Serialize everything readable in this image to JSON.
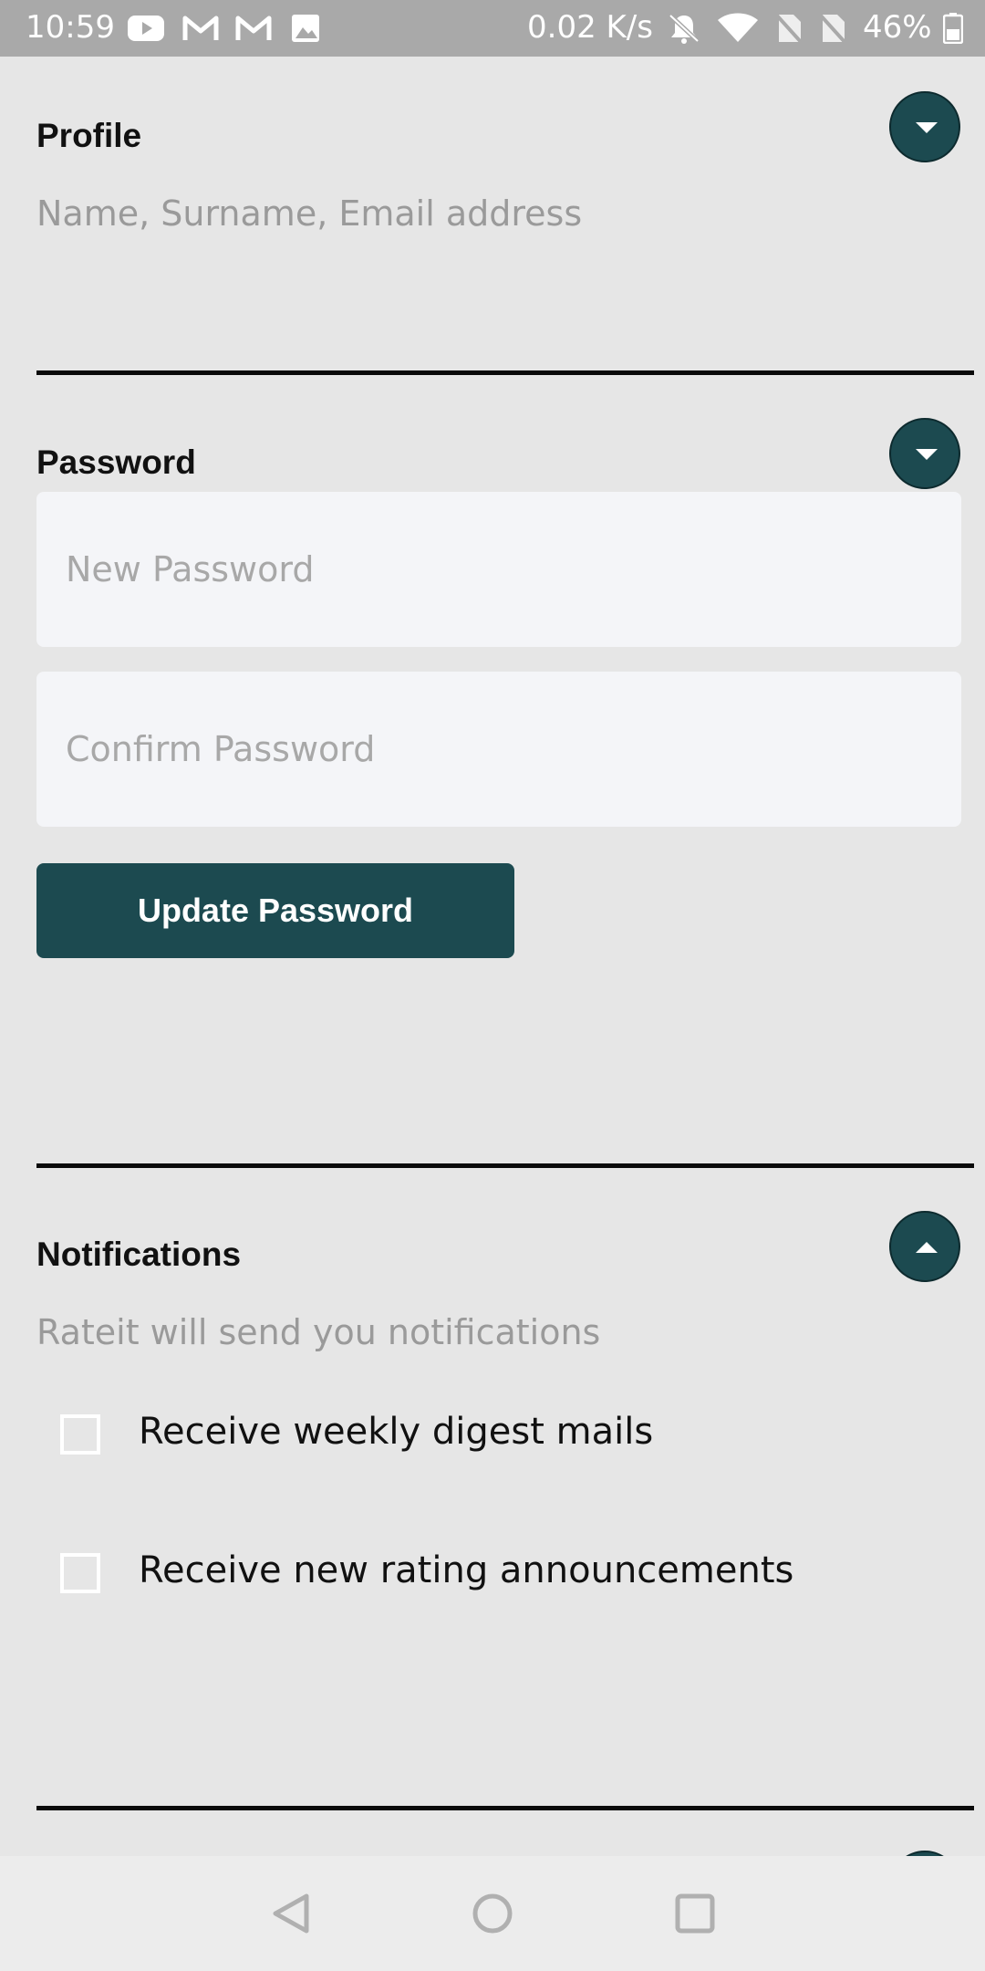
{
  "status_bar": {
    "time": "10:59",
    "network_speed": "0.02 K/s",
    "battery": "46%",
    "icons": [
      "youtube-icon",
      "gmail-icon",
      "gmail-icon",
      "image-icon",
      "bell-muted-icon",
      "wifi-icon",
      "no-sim-icon",
      "no-sim-icon",
      "battery-icon"
    ]
  },
  "profile": {
    "title": "Profile",
    "subtitle": "Name, Surname, Email address"
  },
  "password": {
    "title": "Password",
    "new_password_placeholder": "New Password",
    "confirm_password_placeholder": "Confirm Password",
    "update_button": "Update Password"
  },
  "notifications": {
    "title": "Notifications",
    "subtitle": "Rateit will send you notifications",
    "options": [
      {
        "label": "Receive weekly digest mails",
        "checked": false
      },
      {
        "label": "Receive new rating announcements",
        "checked": false
      }
    ]
  },
  "colors": {
    "accent": "#1c4a50",
    "background": "#e6e6e6",
    "field_background": "#f4f5f8"
  }
}
